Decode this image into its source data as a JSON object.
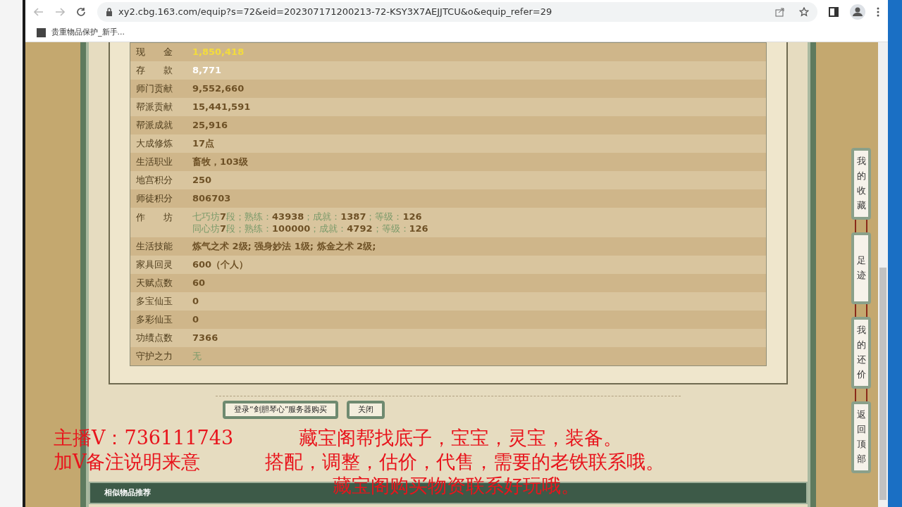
{
  "browser": {
    "url": "xy2.cbg.163.com/equip?s=72&eid=202307171200213-72-KSY3X7AEJJTCU&o&equip_refer=29",
    "bookmark": "贵重物品保护_新手..."
  },
  "rows": [
    {
      "label": "现　　金",
      "kind": "gold",
      "value": "1,850,418"
    },
    {
      "label": "存　　款",
      "kind": "white",
      "value": "8,771"
    },
    {
      "label": "师门贡献",
      "kind": "normal",
      "value": "9,552,660"
    },
    {
      "label": "帮派贡献",
      "kind": "normal",
      "value": "15,441,591"
    },
    {
      "label": "帮派成就",
      "kind": "normal",
      "value": "25,916"
    },
    {
      "label": "大成修炼",
      "kind": "normal",
      "value": "17点"
    },
    {
      "label": "生活职业",
      "kind": "normal",
      "value": "畜牧，103级"
    },
    {
      "label": "地宫积分",
      "kind": "normal",
      "value": "250"
    },
    {
      "label": "师徒积分",
      "kind": "normal",
      "value": "806703"
    },
    {
      "label": "作　　坊",
      "kind": "workshop",
      "lines": [
        [
          {
            "kind": "label",
            "text": "七巧坊"
          },
          {
            "kind": "value",
            "text": "7"
          },
          {
            "kind": "label",
            "text": "段；熟练："
          },
          {
            "kind": "value",
            "text": "43938"
          },
          {
            "kind": "label",
            "text": "；成就："
          },
          {
            "kind": "value",
            "text": "1387"
          },
          {
            "kind": "label",
            "text": "；等级："
          },
          {
            "kind": "value",
            "text": "126"
          }
        ],
        [
          {
            "kind": "label",
            "text": "同心坊"
          },
          {
            "kind": "value",
            "text": "7"
          },
          {
            "kind": "label",
            "text": "段；熟练："
          },
          {
            "kind": "value",
            "text": "100000"
          },
          {
            "kind": "label",
            "text": "；成就："
          },
          {
            "kind": "value",
            "text": "4792"
          },
          {
            "kind": "label",
            "text": "；等级："
          },
          {
            "kind": "value",
            "text": "126"
          }
        ]
      ]
    },
    {
      "label": "生活技能",
      "kind": "normal",
      "value": "炼气之术 2级; 强身妙法 1级; 炼金之术 2级;"
    },
    {
      "label": "家具回灵",
      "kind": "normal",
      "value": "600（个人）"
    },
    {
      "label": "天赋点数",
      "kind": "normal",
      "value": "60"
    },
    {
      "label": "多宝仙玉",
      "kind": "normal",
      "value": "0"
    },
    {
      "label": "多彩仙玉",
      "kind": "normal",
      "value": "0"
    },
    {
      "label": "功绩点数",
      "kind": "normal",
      "value": "7366"
    },
    {
      "label": "守护之力",
      "kind": "muted",
      "value": "无"
    }
  ],
  "buttons": [
    "登录“剑胆琴心”服务器购买",
    "关闭"
  ],
  "section_title": "相似物品推荐",
  "side_buttons": [
    "我的收藏",
    "足迹",
    "我的还价",
    "返回顶部"
  ],
  "overlay_lines": [
    {
      "left": "主播V：736111743",
      "right": "藏宝阁帮找底子，宝宝，灵宝，装备。"
    },
    {
      "left": "加V备注说明来意",
      "right": "搭配，调整，估价，代售，需要的老铁联系哦。"
    },
    {
      "right": "藏宝阁购买物资联系好玩哦。"
    }
  ]
}
